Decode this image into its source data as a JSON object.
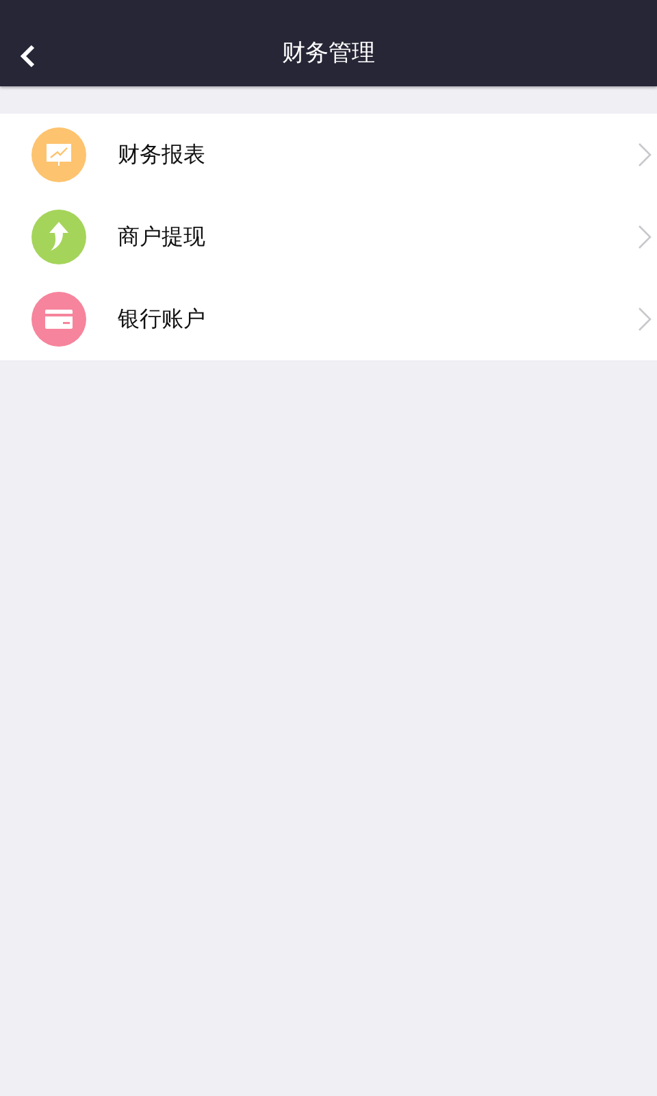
{
  "header": {
    "title": "财务管理"
  },
  "menu": [
    {
      "label": "财务报表",
      "kind": "chart",
      "color": "#fdc36e"
    },
    {
      "label": "商户提现",
      "kind": "withdraw",
      "color": "#a5d45a"
    },
    {
      "label": "银行账户",
      "kind": "card",
      "color": "#f6849c"
    }
  ]
}
